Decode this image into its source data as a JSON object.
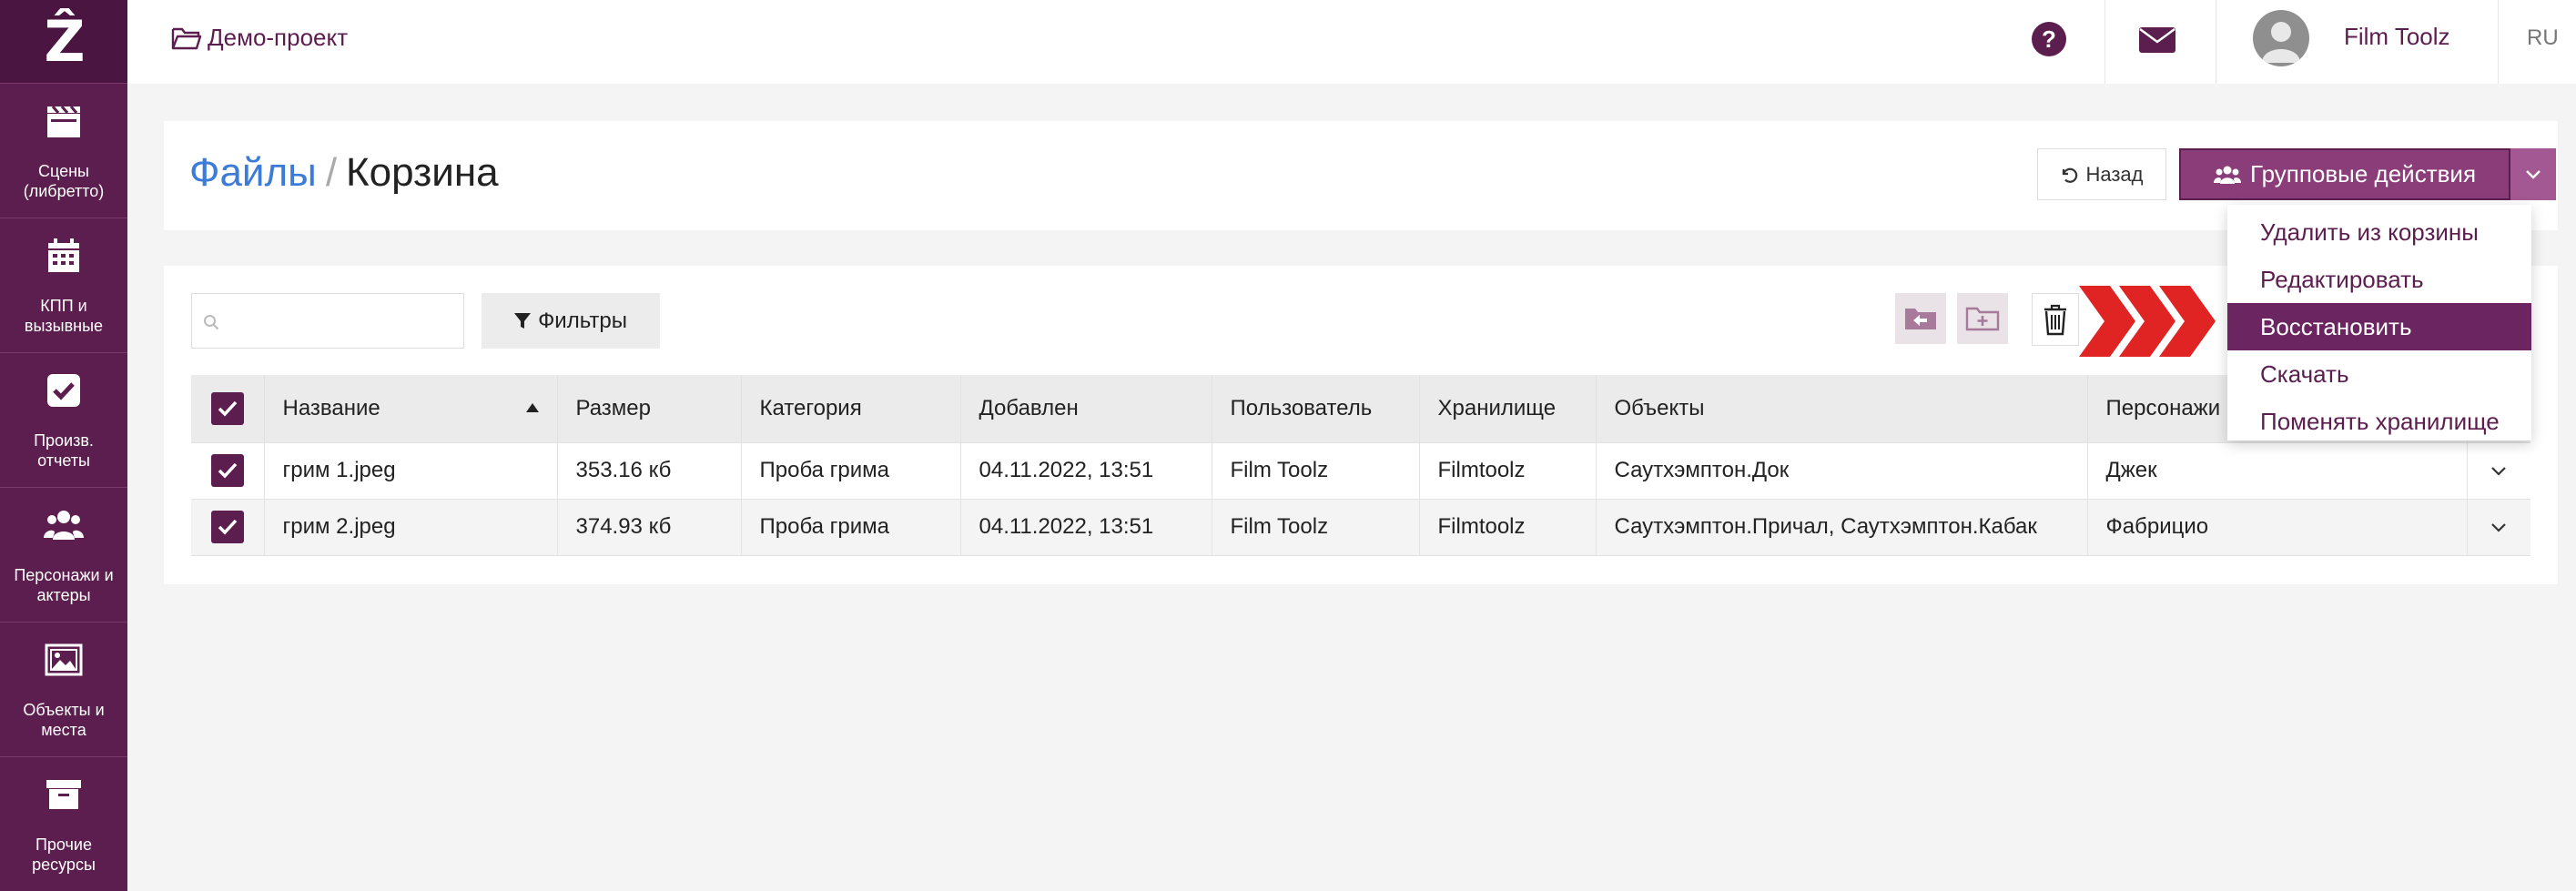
{
  "sidebar": {
    "logo": "Ẑ",
    "items": [
      {
        "label": "Сцены (либретто)",
        "icon": "clapperboard-icon"
      },
      {
        "label": "КПП и вызывные",
        "icon": "calendar-icon"
      },
      {
        "label": "Произв. отчеты",
        "icon": "check-square-icon"
      },
      {
        "label": "Персонажи и актеры",
        "icon": "users-icon"
      },
      {
        "label": "Объекты и места",
        "icon": "image-icon"
      },
      {
        "label": "Прочие ресурсы",
        "icon": "archive-icon"
      }
    ]
  },
  "topbar": {
    "project": "Демо-проект",
    "help": "?",
    "user_name": "Film Toolz",
    "language": "RU"
  },
  "header": {
    "breadcrumb_parent": "Файлы",
    "breadcrumb_separator": "/",
    "breadcrumb_current": "Корзина",
    "back_label": "Назад",
    "group_actions_label": "Групповые действия"
  },
  "toolbar": {
    "search_placeholder": "",
    "filters_label": "Фильтры"
  },
  "table": {
    "columns": [
      "Название",
      "Размер",
      "Категория",
      "Добавлен",
      "Пользователь",
      "Хранилище",
      "Объекты",
      "Персонажи"
    ],
    "rows": [
      {
        "name": "грим 1.jpeg",
        "size": "353.16 кб",
        "category": "Проба грима",
        "added": "04.11.2022, 13:51",
        "user": "Film Toolz",
        "storage": "Filmtoolz",
        "objects": "Саутхэмптон.Док",
        "characters": "Джек"
      },
      {
        "name": "грим 2.jpeg",
        "size": "374.93 кб",
        "category": "Проба грима",
        "added": "04.11.2022, 13:51",
        "user": "Film Toolz",
        "storage": "Filmtoolz",
        "objects": "Саутхэмптон.Причал, Саутхэмптон.Кабак",
        "characters": "Фабрицио"
      }
    ]
  },
  "dropdown": {
    "items": [
      "Удалить из корзины",
      "Редактировать",
      "Восстановить",
      "Скачать",
      "Поменять хранилище"
    ],
    "active": "Восстановить"
  },
  "colors": {
    "brand": "#5c1d4f",
    "accent": "#8a3d79",
    "link": "#3d7bd9",
    "arrow": "#e02424"
  }
}
